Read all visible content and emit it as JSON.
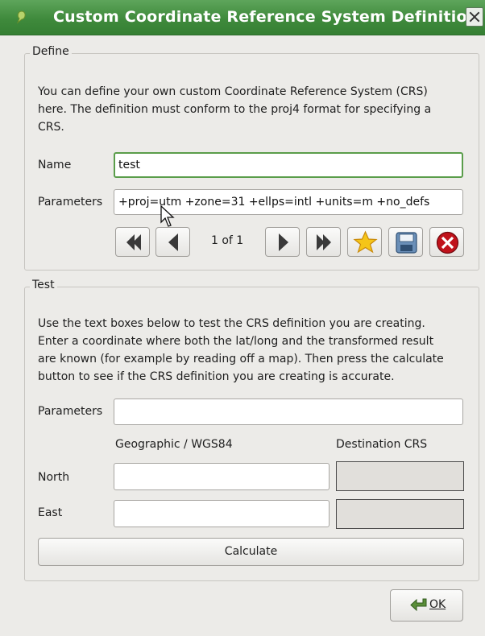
{
  "window": {
    "title": "Custom Coordinate Reference System Definition",
    "app_icon": "qgis-logo-icon",
    "close_icon": "close-icon"
  },
  "define": {
    "legend": "Define",
    "description_lines": [
      "You can define your own custom Coordinate Reference System (CRS)",
      "here. The definition must conform to the proj4 format for specifying a",
      "CRS."
    ],
    "name_label": "Name",
    "name_value": "test",
    "parameters_label": "Parameters",
    "parameters_value": "+proj=utm +zone=31 +ellps=intl +units=m +no_defs",
    "pager": {
      "current": 1,
      "total": 1,
      "text": "1 of 1"
    },
    "toolbar_icons": [
      "first-icon",
      "previous-icon",
      "next-icon",
      "last-icon",
      "new-star-icon",
      "save-disk-icon",
      "delete-icon"
    ]
  },
  "test": {
    "legend": "Test",
    "description_lines": [
      "Use the text boxes below to test the CRS definition you are creating.",
      "Enter a coordinate where both the lat/long and the transformed result",
      "are known (for example by reading off a map). Then press the calculate",
      "button to see if the CRS definition you are creating is accurate."
    ],
    "parameters_label": "Parameters",
    "parameters_value": "",
    "geographic_header": "Geographic / WGS84",
    "destination_header": "Destination CRS",
    "north_label": "North",
    "north_value": "",
    "east_label": "East",
    "east_value": "",
    "calculate_label": "Calculate"
  },
  "footer": {
    "ok_label": "OK",
    "ok_icon": "ok-arrow-icon"
  },
  "colors": {
    "titlebar": "#3f8a3c",
    "focus_border": "#5a9d4a",
    "star": "#f5c518",
    "delete": "#c0121b"
  }
}
